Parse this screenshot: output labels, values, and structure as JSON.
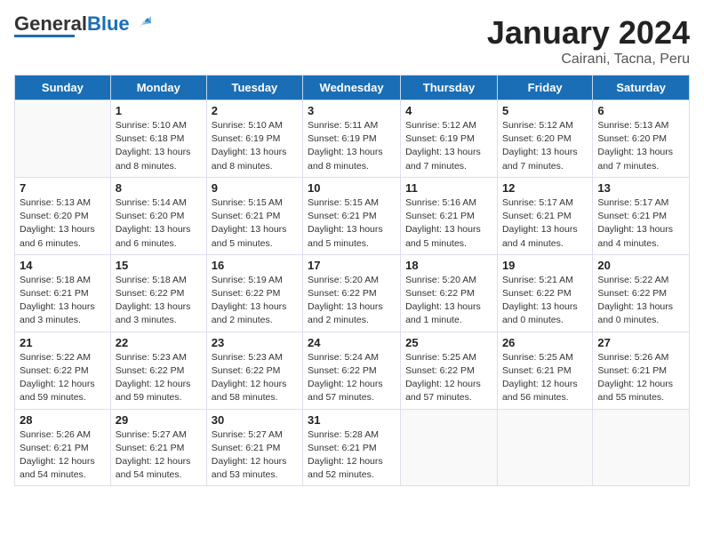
{
  "header": {
    "logo_general": "General",
    "logo_blue": "Blue",
    "title": "January 2024",
    "subtitle": "Cairani, Tacna, Peru"
  },
  "weekdays": [
    "Sunday",
    "Monday",
    "Tuesday",
    "Wednesday",
    "Thursday",
    "Friday",
    "Saturday"
  ],
  "weeks": [
    [
      {
        "day": "",
        "info": ""
      },
      {
        "day": "1",
        "info": "Sunrise: 5:10 AM\nSunset: 6:18 PM\nDaylight: 13 hours\nand 8 minutes."
      },
      {
        "day": "2",
        "info": "Sunrise: 5:10 AM\nSunset: 6:19 PM\nDaylight: 13 hours\nand 8 minutes."
      },
      {
        "day": "3",
        "info": "Sunrise: 5:11 AM\nSunset: 6:19 PM\nDaylight: 13 hours\nand 8 minutes."
      },
      {
        "day": "4",
        "info": "Sunrise: 5:12 AM\nSunset: 6:19 PM\nDaylight: 13 hours\nand 7 minutes."
      },
      {
        "day": "5",
        "info": "Sunrise: 5:12 AM\nSunset: 6:20 PM\nDaylight: 13 hours\nand 7 minutes."
      },
      {
        "day": "6",
        "info": "Sunrise: 5:13 AM\nSunset: 6:20 PM\nDaylight: 13 hours\nand 7 minutes."
      }
    ],
    [
      {
        "day": "7",
        "info": "Sunrise: 5:13 AM\nSunset: 6:20 PM\nDaylight: 13 hours\nand 6 minutes."
      },
      {
        "day": "8",
        "info": "Sunrise: 5:14 AM\nSunset: 6:20 PM\nDaylight: 13 hours\nand 6 minutes."
      },
      {
        "day": "9",
        "info": "Sunrise: 5:15 AM\nSunset: 6:21 PM\nDaylight: 13 hours\nand 5 minutes."
      },
      {
        "day": "10",
        "info": "Sunrise: 5:15 AM\nSunset: 6:21 PM\nDaylight: 13 hours\nand 5 minutes."
      },
      {
        "day": "11",
        "info": "Sunrise: 5:16 AM\nSunset: 6:21 PM\nDaylight: 13 hours\nand 5 minutes."
      },
      {
        "day": "12",
        "info": "Sunrise: 5:17 AM\nSunset: 6:21 PM\nDaylight: 13 hours\nand 4 minutes."
      },
      {
        "day": "13",
        "info": "Sunrise: 5:17 AM\nSunset: 6:21 PM\nDaylight: 13 hours\nand 4 minutes."
      }
    ],
    [
      {
        "day": "14",
        "info": "Sunrise: 5:18 AM\nSunset: 6:21 PM\nDaylight: 13 hours\nand 3 minutes."
      },
      {
        "day": "15",
        "info": "Sunrise: 5:18 AM\nSunset: 6:22 PM\nDaylight: 13 hours\nand 3 minutes."
      },
      {
        "day": "16",
        "info": "Sunrise: 5:19 AM\nSunset: 6:22 PM\nDaylight: 13 hours\nand 2 minutes."
      },
      {
        "day": "17",
        "info": "Sunrise: 5:20 AM\nSunset: 6:22 PM\nDaylight: 13 hours\nand 2 minutes."
      },
      {
        "day": "18",
        "info": "Sunrise: 5:20 AM\nSunset: 6:22 PM\nDaylight: 13 hours\nand 1 minute."
      },
      {
        "day": "19",
        "info": "Sunrise: 5:21 AM\nSunset: 6:22 PM\nDaylight: 13 hours\nand 0 minutes."
      },
      {
        "day": "20",
        "info": "Sunrise: 5:22 AM\nSunset: 6:22 PM\nDaylight: 13 hours\nand 0 minutes."
      }
    ],
    [
      {
        "day": "21",
        "info": "Sunrise: 5:22 AM\nSunset: 6:22 PM\nDaylight: 12 hours\nand 59 minutes."
      },
      {
        "day": "22",
        "info": "Sunrise: 5:23 AM\nSunset: 6:22 PM\nDaylight: 12 hours\nand 59 minutes."
      },
      {
        "day": "23",
        "info": "Sunrise: 5:23 AM\nSunset: 6:22 PM\nDaylight: 12 hours\nand 58 minutes."
      },
      {
        "day": "24",
        "info": "Sunrise: 5:24 AM\nSunset: 6:22 PM\nDaylight: 12 hours\nand 57 minutes."
      },
      {
        "day": "25",
        "info": "Sunrise: 5:25 AM\nSunset: 6:22 PM\nDaylight: 12 hours\nand 57 minutes."
      },
      {
        "day": "26",
        "info": "Sunrise: 5:25 AM\nSunset: 6:21 PM\nDaylight: 12 hours\nand 56 minutes."
      },
      {
        "day": "27",
        "info": "Sunrise: 5:26 AM\nSunset: 6:21 PM\nDaylight: 12 hours\nand 55 minutes."
      }
    ],
    [
      {
        "day": "28",
        "info": "Sunrise: 5:26 AM\nSunset: 6:21 PM\nDaylight: 12 hours\nand 54 minutes."
      },
      {
        "day": "29",
        "info": "Sunrise: 5:27 AM\nSunset: 6:21 PM\nDaylight: 12 hours\nand 54 minutes."
      },
      {
        "day": "30",
        "info": "Sunrise: 5:27 AM\nSunset: 6:21 PM\nDaylight: 12 hours\nand 53 minutes."
      },
      {
        "day": "31",
        "info": "Sunrise: 5:28 AM\nSunset: 6:21 PM\nDaylight: 12 hours\nand 52 minutes."
      },
      {
        "day": "",
        "info": ""
      },
      {
        "day": "",
        "info": ""
      },
      {
        "day": "",
        "info": ""
      }
    ]
  ]
}
